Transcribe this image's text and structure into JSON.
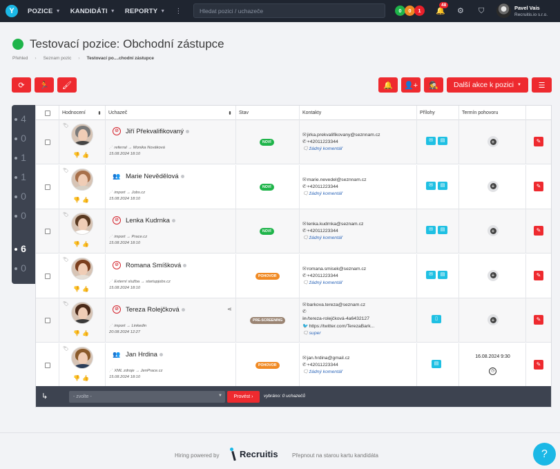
{
  "topbar": {
    "logo": "Y",
    "nav": [
      {
        "label": "POZICE"
      },
      {
        "label": "KANDIDÁTI"
      },
      {
        "label": "REPORTY"
      }
    ],
    "more": "⋮",
    "search_placeholder": "Hledat pozici / uchazeče",
    "counters": [
      {
        "value": "0",
        "color": "#1fb44a"
      },
      {
        "value": "0",
        "color": "#f08a24"
      },
      {
        "value": "1",
        "color": "#e8202a"
      }
    ],
    "notifications_count": "48",
    "user_name": "Pavel Vais",
    "user_org": "Recruitis.io s.r.o."
  },
  "header": {
    "title": "Testovací pozice: Obchodní zástupce",
    "status_color": "#1fb44a",
    "breadcrumb": [
      "Přehled",
      "Seznam pozic",
      "Testovací po....chodní zástupce"
    ]
  },
  "actions": {
    "more_actions_label": "Další akce k pozici"
  },
  "rail": {
    "numbers": [
      "4",
      "0",
      "1",
      "1",
      "0",
      "0",
      "6",
      "0"
    ],
    "active_index": 6
  },
  "table": {
    "headers": {
      "rating": "Hodnocení",
      "candidate": "Uchazeč",
      "state": "Stav",
      "contacts": "Kontakty",
      "attachments": "Přílohy",
      "interview": "Termín pohovoru"
    },
    "rows": [
      {
        "name": "Jiří Překvalifikovaný",
        "icon": "block",
        "source": "referral → Monika Nováková",
        "date": "15.08.2024 18:10",
        "state": "NOVÍ",
        "state_kind": "novy",
        "contacts": [
          "jirka.prekvalifikovany@seznnam.cz",
          "+42011223344",
          "žádný komentář"
        ],
        "attachments": 2,
        "interview": "",
        "photo": {
          "hair": "#7a7a7a",
          "body": "#444"
        }
      },
      {
        "name": "Marie Nevědělová",
        "icon": "team",
        "source": "import → Jobs.cz",
        "date": "15.08.2024 18:10",
        "state": "NOVÍ",
        "state_kind": "novy",
        "contacts": [
          "marie.nevedel@seznnam.cz",
          "+42011223344",
          "žádný komentář"
        ],
        "attachments": 2,
        "interview": "",
        "photo": {
          "hair": "#a8704a",
          "body": "#d7d1c7"
        }
      },
      {
        "name": "Lenka Kudrnka",
        "icon": "block",
        "source": "import → Prace.cz",
        "date": "15.08.2024 18:10",
        "state": "NOVÍ",
        "state_kind": "novy",
        "contacts": [
          "lenka.kudrnka@seznam.cz",
          "+42011223344",
          "žádný komentář"
        ],
        "attachments": 2,
        "interview": "",
        "photo": {
          "hair": "#5a3a22",
          "body": "#ffffff"
        }
      },
      {
        "name": "Romana Smíšková",
        "icon": "block",
        "source": "Externí služba → startupjobs.cz",
        "date": "15.08.2024 18:10",
        "state": "POHOVOR",
        "state_kind": "pohovor",
        "contacts": [
          "romana.smisek@seznam.cz",
          "+42011223344",
          "žádný komentář"
        ],
        "attachments": 2,
        "interview": "",
        "photo": {
          "hair": "#7a3d1c",
          "body": "#e6e0d8"
        }
      },
      {
        "name": "Tereza Rolejčková",
        "icon": "block",
        "source": "import → Linkedin",
        "date": "20.08.2024 12:27",
        "state": "PRE-SCREENING",
        "state_kind": "pre",
        "contacts": [
          "barkova.tereza@seznam.cz",
          "",
          "/tereza-rolejčková-4a6432127",
          "https://twitter.com/TerezaBark...",
          "super"
        ],
        "attachments": 1,
        "interview": "",
        "photo": {
          "hair": "#4a2a1a",
          "body": "#3a3a3a"
        }
      },
      {
        "name": "Jan Hrdina",
        "icon": "team",
        "source": "XML zdroje → JenPrace.cz",
        "date": "15.08.2024 18:10",
        "state": "POHOVOR",
        "state_kind": "pohovor",
        "contacts": [
          "jan.hrdina@gmail.cz",
          "+42011223344",
          "žádný komentář"
        ],
        "attachments": 1,
        "interview": "16.08.2024 9:30",
        "photo": {
          "hair": "#8a5a2a",
          "body": "#2c3e5a"
        }
      }
    ],
    "footer": {
      "select_placeholder": "- zvolte -",
      "execute_label": "Provést ›",
      "selection_info": "vybráno: 0 uchazečů"
    }
  },
  "page_footer": {
    "powered": "Hiring powered by",
    "brand": "Recruitis",
    "switch_link": "Přepnout na starou kartu kandidáta",
    "help": "?"
  }
}
